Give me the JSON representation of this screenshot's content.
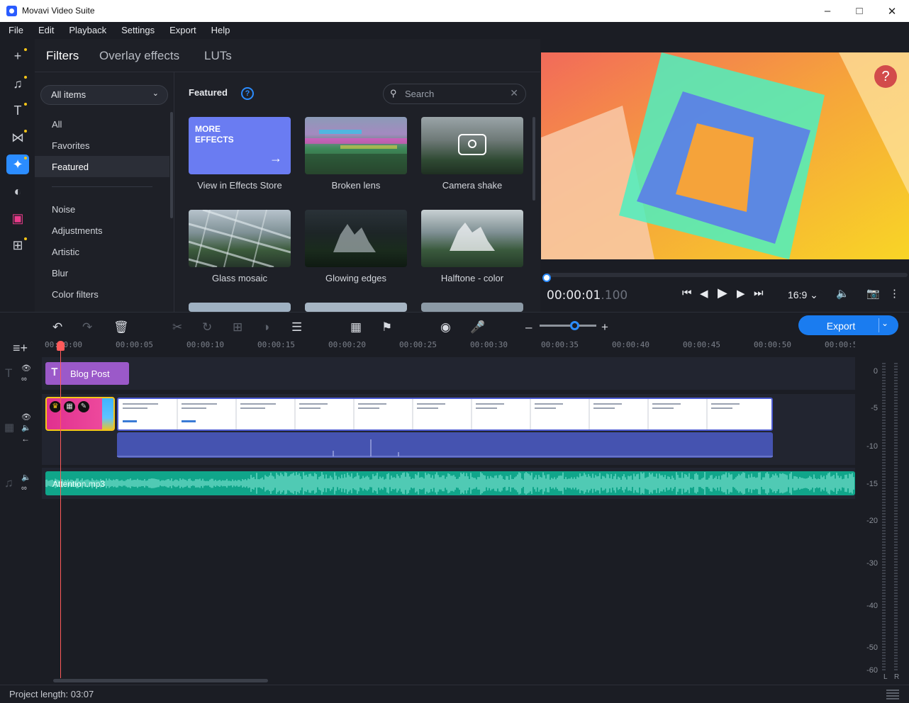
{
  "window": {
    "title": "Movavi Video Suite"
  },
  "menu": [
    "File",
    "Edit",
    "Playback",
    "Settings",
    "Export",
    "Help"
  ],
  "effects_panel": {
    "tabs": [
      "Filters",
      "Overlay effects",
      "LUTs"
    ],
    "category_select": "All items",
    "categories_top": [
      "All",
      "Favorites",
      "Featured"
    ],
    "categories_bottom": [
      "Noise",
      "Adjustments",
      "Artistic",
      "Blur",
      "Color filters"
    ],
    "section_title": "Featured",
    "search_placeholder": "Search",
    "more_effects_line1": "MORE",
    "more_effects_line2": "EFFECTS",
    "items": [
      "View in Effects Store",
      "Broken lens",
      "Camera shake",
      "Glass mosaic",
      "Glowing edges",
      "Halftone - color"
    ]
  },
  "player": {
    "timecode_main": "00:00:01",
    "timecode_ms": ".100",
    "aspect_ratio": "16:9",
    "help": "?"
  },
  "toolbar": {
    "export_label": "Export"
  },
  "ruler_ticks": [
    "00:00:00",
    "00:00:05",
    "00:00:10",
    "00:00:15",
    "00:00:20",
    "00:00:25",
    "00:00:30",
    "00:00:35",
    "00:00:40",
    "00:00:45",
    "00:00:50",
    "00:00:5"
  ],
  "timeline": {
    "title_clip": "Blog Post",
    "audio_clip": "Attention.mp3"
  },
  "meter_labels": [
    "0",
    "-5",
    "-10",
    "-15",
    "-20",
    "-30",
    "-40",
    "-50",
    "-60"
  ],
  "meter_channels": [
    "L",
    "R"
  ],
  "status": {
    "project_length": "Project length: 03:07"
  },
  "colors": {
    "accent": "#2b8cff",
    "title_clip": "#9b59c9",
    "audio_clip": "#10a58a",
    "playhead": "#ff5a5a"
  }
}
